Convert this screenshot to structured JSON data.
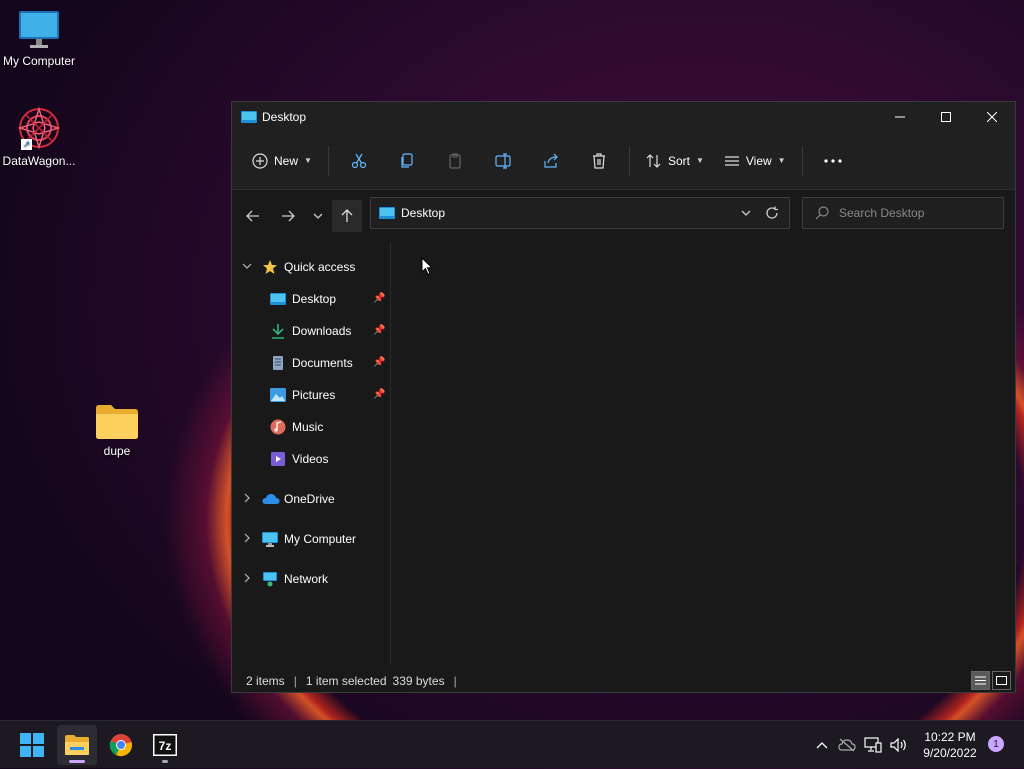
{
  "desktop": {
    "icons": [
      {
        "label": "My Computer"
      },
      {
        "label": "DataWagon..."
      },
      {
        "label": "dupe"
      }
    ]
  },
  "window": {
    "title": "Desktop",
    "toolbar": {
      "new_label": "New",
      "sort_label": "Sort",
      "view_label": "View"
    },
    "address": {
      "path": "Desktop"
    },
    "search": {
      "placeholder": "Search Desktop"
    },
    "nav": {
      "quick_access": "Quick access",
      "items": [
        {
          "label": "Desktop",
          "pinned": true
        },
        {
          "label": "Downloads",
          "pinned": true
        },
        {
          "label": "Documents",
          "pinned": true
        },
        {
          "label": "Pictures",
          "pinned": true
        },
        {
          "label": "Music",
          "pinned": false
        },
        {
          "label": "Videos",
          "pinned": false
        }
      ],
      "onedrive": "OneDrive",
      "my_computer": "My Computer",
      "network": "Network"
    },
    "status": {
      "items": "2 items",
      "sep": "|",
      "selected": "1 item selected",
      "size": "339 bytes"
    }
  },
  "taskbar": {
    "clock_time": "10:22 PM",
    "clock_date": "9/20/2022",
    "notification_count": "1"
  },
  "colors": {
    "accent": "#c9a6ff",
    "folder": "#f5c542",
    "window_bg": "#191919"
  }
}
